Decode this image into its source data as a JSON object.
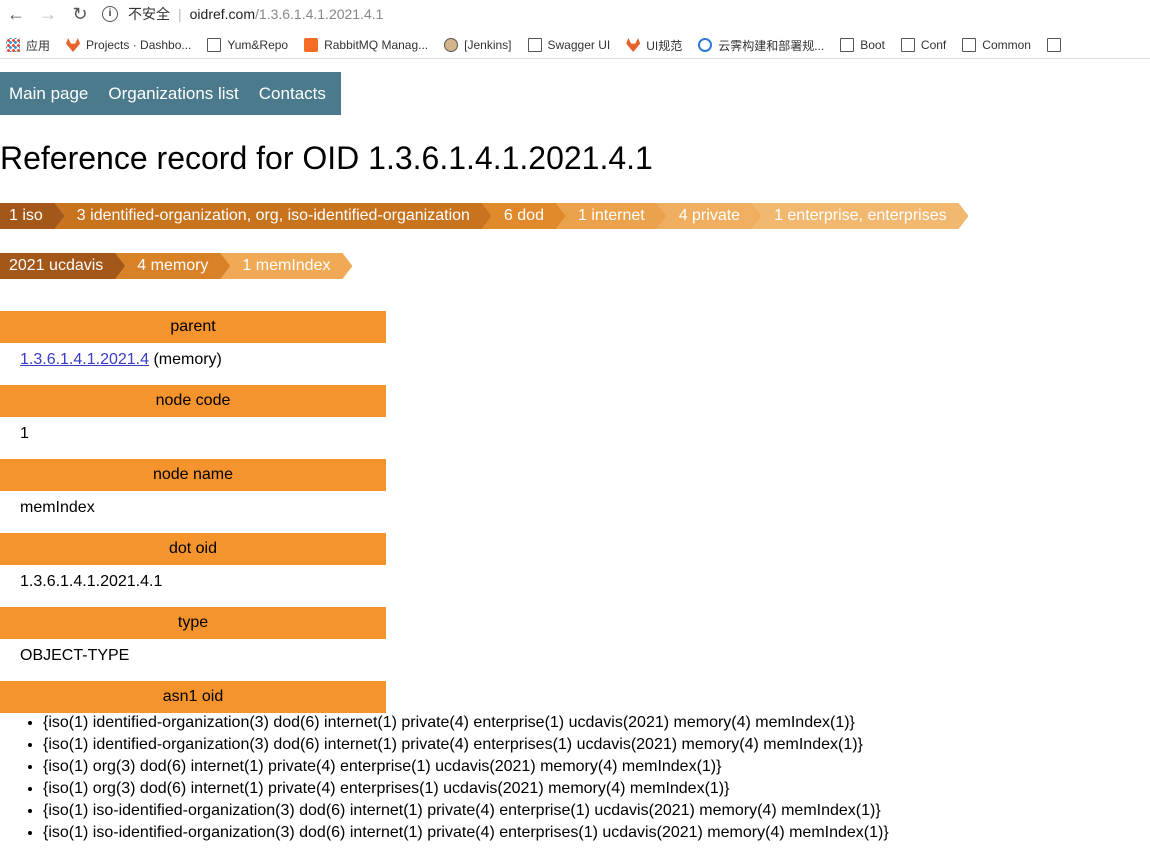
{
  "browser": {
    "security_label": "不安全",
    "url_host": "oidref.com",
    "url_path": "/1.3.6.1.4.1.2021.4.1",
    "bookmarks": [
      {
        "label": "应用",
        "icon": "apps-grid-icon"
      },
      {
        "label": "Projects · Dashbo...",
        "icon": "gitlab-icon"
      },
      {
        "label": "Yum&Repo",
        "icon": "page-icon"
      },
      {
        "label": "RabbitMQ Manag...",
        "icon": "rabbitmq-icon"
      },
      {
        "label": "[Jenkins]",
        "icon": "jenkins-icon"
      },
      {
        "label": "Swagger UI",
        "icon": "page-icon"
      },
      {
        "label": "UI规范",
        "icon": "gitlab-icon"
      },
      {
        "label": "云霁构建和部署规...",
        "icon": "wheel-icon"
      },
      {
        "label": "Boot",
        "icon": "folder-icon"
      },
      {
        "label": "Conf",
        "icon": "folder-icon"
      },
      {
        "label": "Common",
        "icon": "folder-icon"
      }
    ]
  },
  "nav": {
    "main": "Main page",
    "orgs": "Organizations list",
    "contacts": "Contacts"
  },
  "title": "Reference record for OID 1.3.6.1.4.1.2021.4.1",
  "breadcrumb_row1": [
    {
      "label": "1 iso",
      "color": "#a3581a"
    },
    {
      "label": "3 identified-organization, org, iso-identified-organization",
      "color": "#c8731e"
    },
    {
      "label": "6 dod",
      "color": "#e08a2c"
    },
    {
      "label": "1 internet",
      "color": "#eba24c"
    },
    {
      "label": "4 private",
      "color": "#efae60"
    },
    {
      "label": "1 enterprise, enterprises",
      "color": "#f2b870"
    }
  ],
  "breadcrumb_row2": [
    {
      "label": "2021 ucdavis",
      "color": "#a3581a"
    },
    {
      "label": "4 memory",
      "color": "#d98126"
    },
    {
      "label": "1 memIndex",
      "color": "#f0aa55"
    }
  ],
  "parent": {
    "header": "parent",
    "link": "1.3.6.1.4.1.2021.4",
    "suffix": " (memory)"
  },
  "node_code": {
    "header": "node code",
    "value": "1"
  },
  "node_name": {
    "header": "node name",
    "value": "memIndex"
  },
  "dot_oid": {
    "header": "dot oid",
    "value": "1.3.6.1.4.1.2021.4.1"
  },
  "type": {
    "header": "type",
    "value": "OBJECT-TYPE"
  },
  "asn1": {
    "header": "asn1 oid",
    "items": [
      "{iso(1) identified-organization(3) dod(6) internet(1) private(4) enterprise(1) ucdavis(2021) memory(4) memIndex(1)}",
      "{iso(1) identified-organization(3) dod(6) internet(1) private(4) enterprises(1) ucdavis(2021) memory(4) memIndex(1)}",
      "{iso(1) org(3) dod(6) internet(1) private(4) enterprise(1) ucdavis(2021) memory(4) memIndex(1)}",
      "{iso(1) org(3) dod(6) internet(1) private(4) enterprises(1) ucdavis(2021) memory(4) memIndex(1)}",
      "{iso(1) iso-identified-organization(3) dod(6) internet(1) private(4) enterprise(1) ucdavis(2021) memory(4) memIndex(1)}",
      "{iso(1) iso-identified-organization(3) dod(6) internet(1) private(4) enterprises(1) ucdavis(2021) memory(4) memIndex(1)}"
    ]
  }
}
